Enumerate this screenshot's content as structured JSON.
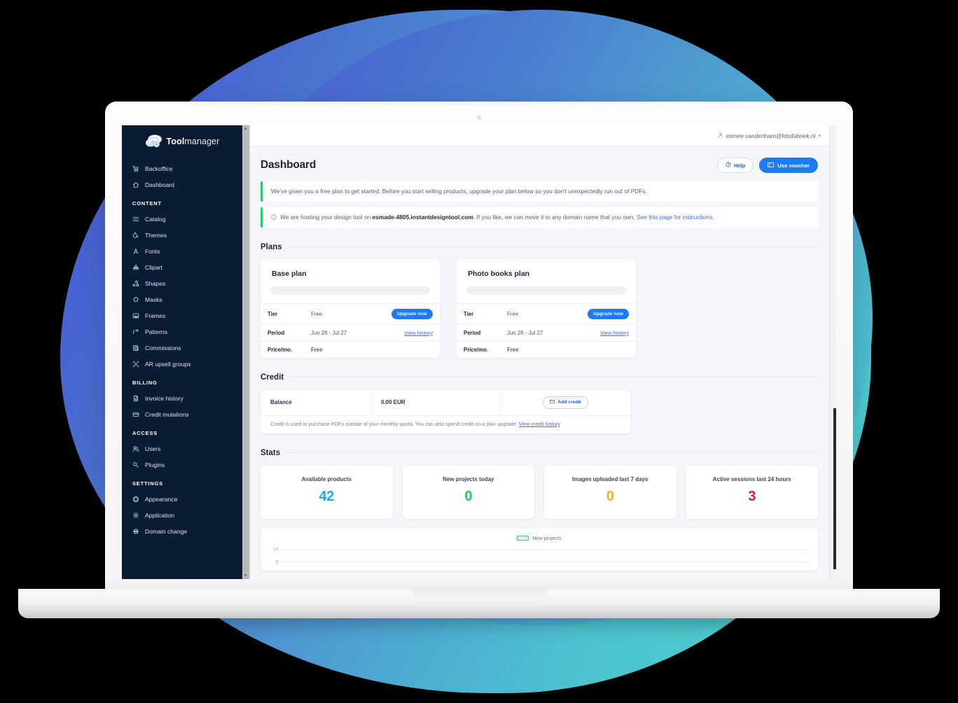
{
  "brand": {
    "name_bold": "Tool",
    "name_light": "manager",
    "logo_icon": "toolmanager-logo-icon"
  },
  "topbar": {
    "user_icon": "user-icon",
    "user_email": "esmee.vandenham@fotofabriek.nl",
    "caret": "▾"
  },
  "sidebar": {
    "groups": [
      {
        "title": "",
        "items": [
          {
            "label": "Backoffice",
            "icon": "cart-icon"
          },
          {
            "label": "Dashboard",
            "icon": "home-icon"
          }
        ]
      },
      {
        "title": "CONTENT",
        "items": [
          {
            "label": "Catalog",
            "icon": "list-icon"
          },
          {
            "label": "Themes",
            "icon": "droplet-icon"
          },
          {
            "label": "Fonts",
            "icon": "font-a-icon"
          },
          {
            "label": "Clipart",
            "icon": "clipart-icon"
          },
          {
            "label": "Shapes",
            "icon": "shapes-icon"
          },
          {
            "label": "Masks",
            "icon": "mask-icon"
          },
          {
            "label": "Frames",
            "icon": "frame-icon"
          },
          {
            "label": "Patterns",
            "icon": "pattern-arrow-icon"
          },
          {
            "label": "Commissions",
            "icon": "commissions-icon"
          },
          {
            "label": "AR upsell groups",
            "icon": "ar-icon"
          }
        ]
      },
      {
        "title": "BILLING",
        "items": [
          {
            "label": "Invoice history",
            "icon": "document-icon"
          },
          {
            "label": "Credit mutations",
            "icon": "card-icon"
          }
        ]
      },
      {
        "title": "ACCESS",
        "items": [
          {
            "label": "Users",
            "icon": "users-icon"
          },
          {
            "label": "Plugins",
            "icon": "plug-icon"
          }
        ]
      },
      {
        "title": "SETTINGS",
        "items": [
          {
            "label": "Appearance",
            "icon": "palette-icon"
          },
          {
            "label": "Application",
            "icon": "gear-icon"
          },
          {
            "label": "Domain change",
            "icon": "globe-icon"
          }
        ]
      }
    ]
  },
  "page": {
    "title": "Dashboard",
    "help_button": "Help",
    "help_icon": "question-circle-icon",
    "voucher_button": "Use voucher",
    "voucher_icon": "ticket-icon"
  },
  "notices": [
    {
      "icon": "",
      "text": "We've given you a free plan to get started. Before you start selling products, upgrade your plan below so you don't unexpectedly run out of PDFs.",
      "accent": "#2ecc71"
    },
    {
      "icon": "info-circle-icon",
      "text_before": "We are hosting your design tool on ",
      "bold": "esmade-4805.instantdesigntool.com",
      "text_after": ". If you like, we can move it to any domain name that you own. ",
      "link": "See this page for instructions.",
      "accent": "#2ecc71"
    }
  ],
  "plans": {
    "section_title": "Plans",
    "row_labels": {
      "tier": "Tier",
      "period": "Period",
      "price": "Price/mo."
    },
    "upgrade_label": "Upgrade now",
    "history_label": "View history",
    "cards": [
      {
        "title": "Base plan",
        "tier": "Free",
        "period": "Jun 28 - Jul 27",
        "price": "Free"
      },
      {
        "title": "Photo books plan",
        "tier": "Free",
        "period": "Jun 28 - Jul 27",
        "price": "Free"
      }
    ]
  },
  "credit": {
    "section_title": "Credit",
    "balance_label": "Balance",
    "balance_value": "0.00 EUR",
    "add_credit_label": "Add credit",
    "add_credit_icon": "card-icon",
    "note": "Credit is used to purchase PDFs outside of your monthly quota. You can also spend credit on a plan upgrade. ",
    "note_link": "View credit history"
  },
  "stats": {
    "section_title": "Stats",
    "cards": [
      {
        "label": "Available products",
        "value": "42",
        "color": "#22a9df"
      },
      {
        "label": "New projects today",
        "value": "0",
        "color": "#1fc860"
      },
      {
        "label": "Images uploaded last 7 days",
        "value": "0",
        "color": "#f5b41a"
      },
      {
        "label": "Active sessions last 24 hours",
        "value": "3",
        "color": "#cf1a42"
      }
    ]
  },
  "chart_data": {
    "type": "line",
    "title": "",
    "legend": [
      {
        "name": "New projects",
        "color": "#4cc27a",
        "fill": "#d8f3e0"
      }
    ],
    "legend_position": "top-center",
    "x": [],
    "series": [
      {
        "name": "New projects",
        "values": []
      }
    ],
    "ylabel": "",
    "xlabel": "",
    "ylim": [
      0,
      10
    ],
    "visible_yticks": [
      "10",
      "9"
    ],
    "grid": true,
    "note": "Chart is clipped by the viewport; only legend and the topmost gridlines (10 and 9) are visible."
  }
}
